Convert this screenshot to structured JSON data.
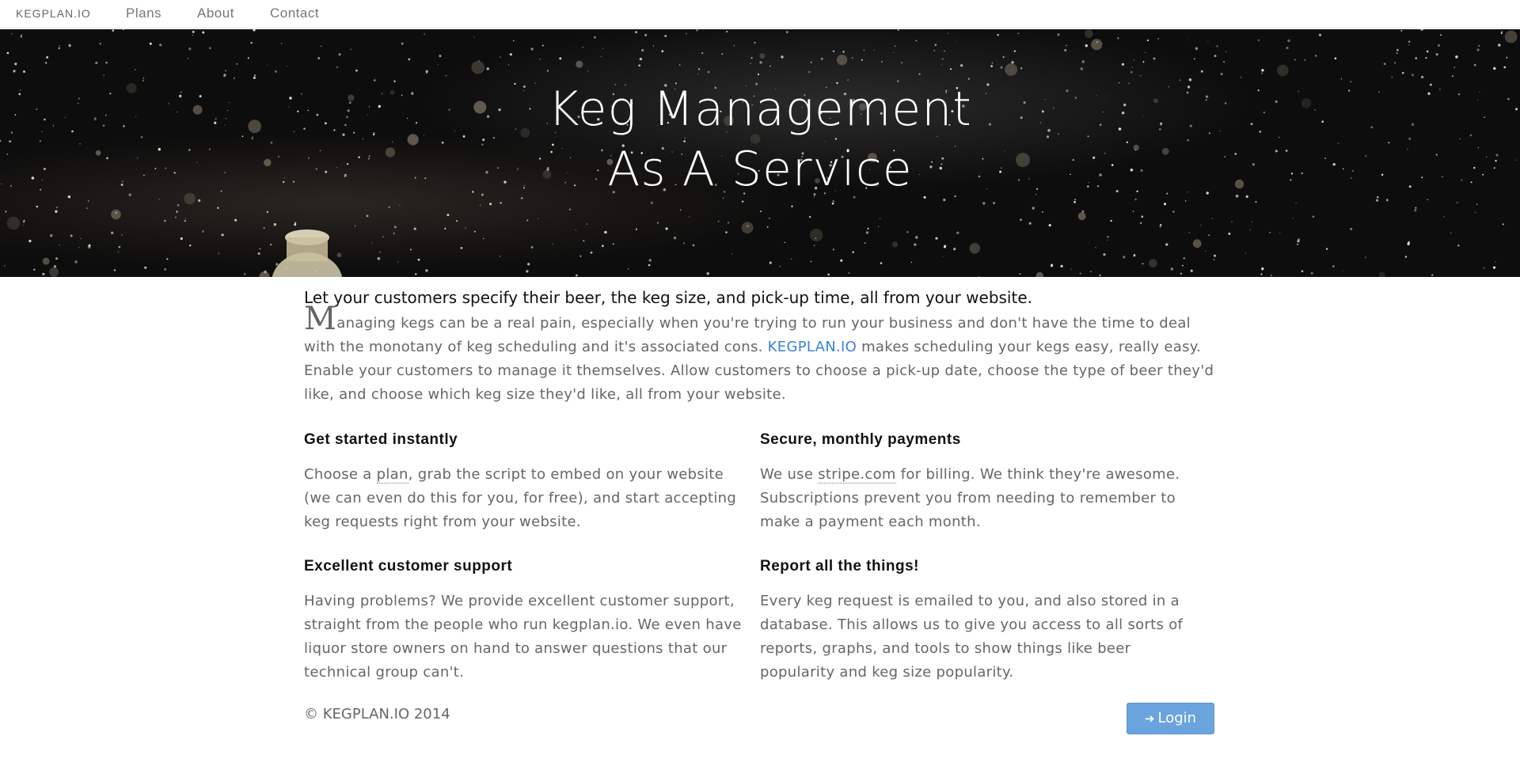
{
  "nav": {
    "brand": "KEGPLAN.IO",
    "items": [
      "Plans",
      "About",
      "Contact"
    ]
  },
  "hero": {
    "title_line1": "Keg Management",
    "title_line2": "As A Service"
  },
  "intro": {
    "lead": "Let your customers specify their beer, the keg size, and pick-up time, all from your website.",
    "dropcap": "M",
    "text_part1": "anaging kegs can be a real pain, especially when you're trying to run your business and don't have the time to deal with the monotany of keg scheduling and it's associated cons. ",
    "brand_link": "KEGPLAN.IO",
    "text_part2": " makes scheduling your kegs easy, really easy. Enable your customers to manage it themselves. Allow customers to choose a pick-up date, choose the type of beer they'd like, and choose which keg size they'd like, all from your website."
  },
  "features": {
    "f1": {
      "title": "Get started instantly",
      "pre": "Choose a ",
      "link": "plan",
      "post": ", grab the script to embed on your website (we can even do this for you, for free), and start accepting keg requests right from your website."
    },
    "f2": {
      "title": "Secure, monthly payments",
      "pre": "We use ",
      "link": "stripe.com",
      "post": " for billing. We think they're awesome. Subscriptions prevent you from needing to remember to make a payment each month."
    },
    "f3": {
      "title": "Excellent customer support",
      "text": "Having problems? We provide excellent customer support, straight from the people who run kegplan.io. We even have liquor store owners on hand to answer questions that our technical group can't."
    },
    "f4": {
      "title": "Report all the things!",
      "text": "Every keg request is emailed to you, and also stored in a database. This allows us to give you access to all sorts of reports, graphs, and tools to show things like beer popularity and keg size popularity."
    }
  },
  "footer": {
    "copyright": "© KEGPLAN.IO 2014",
    "login_label": "Login",
    "login_icon": "sign-in-icon"
  },
  "colors": {
    "link": "#3a84d8",
    "button": "#6ba3de"
  }
}
